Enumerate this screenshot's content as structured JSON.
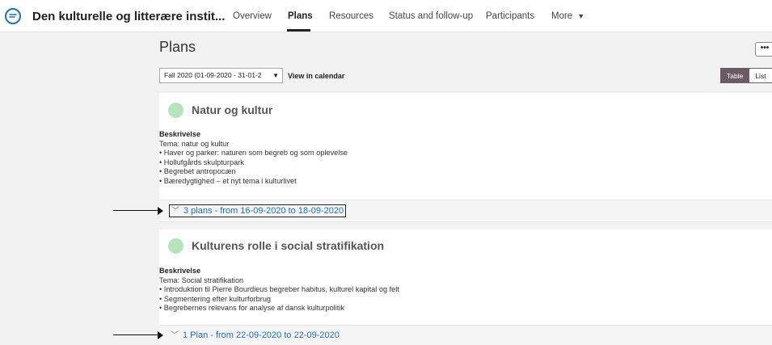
{
  "app": {
    "title": "Den kulturelle og litterære instit...",
    "logo_icon": "chat-logo-icon",
    "accent": "#1f6fb4"
  },
  "nav": {
    "tabs": [
      {
        "label": "Overview"
      },
      {
        "label": "Plans",
        "active": true
      },
      {
        "label": "Resources"
      },
      {
        "label": "Status and follow-up"
      },
      {
        "label": "Participants"
      },
      {
        "label": "More"
      }
    ]
  },
  "page": {
    "title": "Plans",
    "more_button": "•••"
  },
  "filters": {
    "period": "Fall 2020 (01-09-2020 - 31-01-2",
    "calendar_link": "View in calendar"
  },
  "view_toggle": {
    "table": "Table",
    "list": "List",
    "active": "Table",
    "active_color": "#6b5b66"
  },
  "cards": [
    {
      "title": "Natur og kultur",
      "dot_color": "#b7e4bd",
      "description_label": "Beskrivelse",
      "lines": [
        "Tema: natur og kultur",
        "• Haver og parker: naturen som begreb og som oplevelse",
        "• Hollufgårds skulpturpark",
        "• Begrebet antropocæn",
        "• Bæredygtighed – et nyt tema i kulturlivet"
      ],
      "plans_link": "3 plans - from 16-09-2020 to 18-09-2020"
    },
    {
      "title": "Kulturens rolle i social stratifikation",
      "dot_color": "#b7e4bd",
      "description_label": "Beskrivelse",
      "lines": [
        "Tema: Social stratifikation",
        "• Introduktion til Pierre Bourdieus begreber habitus, kulturel kapital og felt",
        "• Segmentering efter kulturforbrug",
        "• Begrebernes relevans for analyse af dansk kulturpolitik"
      ],
      "plans_link": "1 Plan - from 22-09-2020 to 22-09-2020"
    }
  ]
}
